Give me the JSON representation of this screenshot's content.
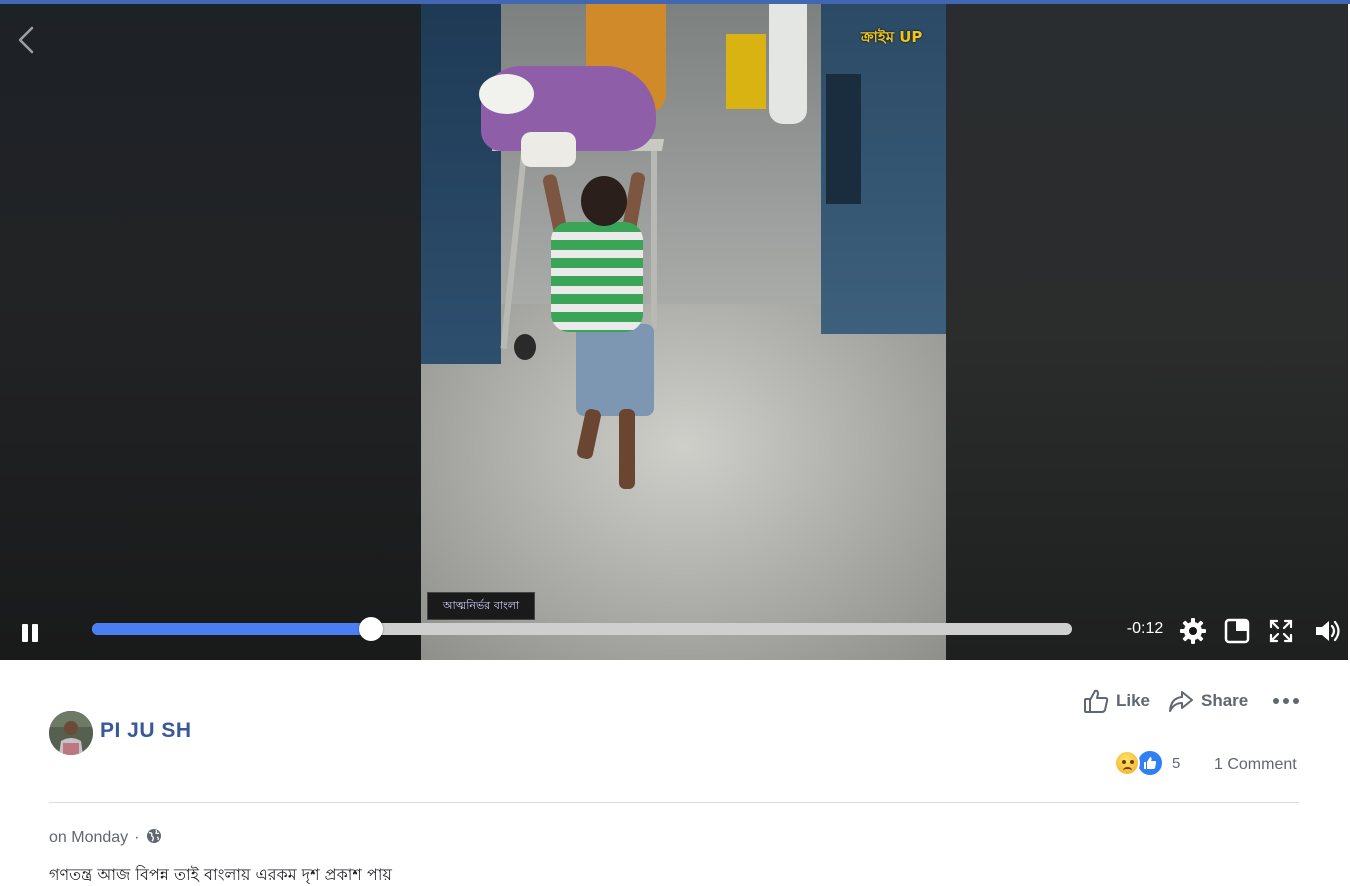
{
  "player": {
    "channel_logo": "ক্রাইম UP",
    "caption_overlay": "আত্মনির্ভর বাংলা",
    "progress": 0.285,
    "time_remaining": "-0:12",
    "accent_color": "#4b7ef2",
    "icons": [
      "back-arrow-icon",
      "pause-icon",
      "settings-gear-icon",
      "picture-in-picture-icon",
      "fullscreen-icon",
      "volume-icon"
    ]
  },
  "post": {
    "author_name": "PI JU SH",
    "actions": {
      "like_label": "Like",
      "share_label": "Share"
    },
    "reactions": {
      "types": [
        "sad",
        "like"
      ],
      "count": "5"
    },
    "comments_label": "1 Comment",
    "timestamp": "on Monday",
    "separator": "·",
    "privacy_icon": "globe-icon",
    "caption": "গণতন্ত্র আজ বিপন্ন তাই বাংলায় এরকম দৃশ প্রকাশ পায়",
    "link_color": "#385898"
  }
}
